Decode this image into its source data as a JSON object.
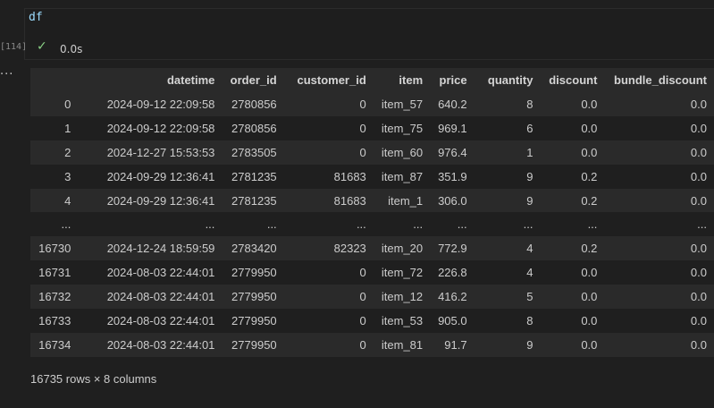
{
  "cell": {
    "code": "df",
    "execution_count": "[114]",
    "status_icon": "check-icon",
    "exec_time": "0.0s",
    "output_menu": "..."
  },
  "table": {
    "columns": [
      "",
      "datetime",
      "order_id",
      "customer_id",
      "item",
      "price",
      "quantity",
      "discount",
      "bundle_discount"
    ],
    "rows": [
      [
        "0",
        "2024-09-12 22:09:58",
        "2780856",
        "0",
        "item_57",
        "640.2",
        "8",
        "0.0",
        "0.0"
      ],
      [
        "1",
        "2024-09-12 22:09:58",
        "2780856",
        "0",
        "item_75",
        "969.1",
        "6",
        "0.0",
        "0.0"
      ],
      [
        "2",
        "2024-12-27 15:53:53",
        "2783505",
        "0",
        "item_60",
        "976.4",
        "1",
        "0.0",
        "0.0"
      ],
      [
        "3",
        "2024-09-29 12:36:41",
        "2781235",
        "81683",
        "item_87",
        "351.9",
        "9",
        "0.2",
        "0.0"
      ],
      [
        "4",
        "2024-09-29 12:36:41",
        "2781235",
        "81683",
        "item_1",
        "306.0",
        "9",
        "0.2",
        "0.0"
      ],
      [
        "...",
        "...",
        "...",
        "...",
        "...",
        "...",
        "...",
        "...",
        "..."
      ],
      [
        "16730",
        "2024-12-24 18:59:59",
        "2783420",
        "82323",
        "item_20",
        "772.9",
        "4",
        "0.2",
        "0.0"
      ],
      [
        "16731",
        "2024-08-03 22:44:01",
        "2779950",
        "0",
        "item_72",
        "226.8",
        "4",
        "0.0",
        "0.0"
      ],
      [
        "16732",
        "2024-08-03 22:44:01",
        "2779950",
        "0",
        "item_12",
        "416.2",
        "5",
        "0.0",
        "0.0"
      ],
      [
        "16733",
        "2024-08-03 22:44:01",
        "2779950",
        "0",
        "item_53",
        "905.0",
        "8",
        "0.0",
        "0.0"
      ],
      [
        "16734",
        "2024-08-03 22:44:01",
        "2779950",
        "0",
        "item_81",
        "91.7",
        "9",
        "0.0",
        "0.0"
      ]
    ]
  },
  "shape_note": "16735 rows × 8 columns",
  "colors": {
    "background": "#1f1f1f",
    "header_row": "#2a2a2a",
    "success_check": "#89d185",
    "code_variable": "#9cdcfe"
  }
}
